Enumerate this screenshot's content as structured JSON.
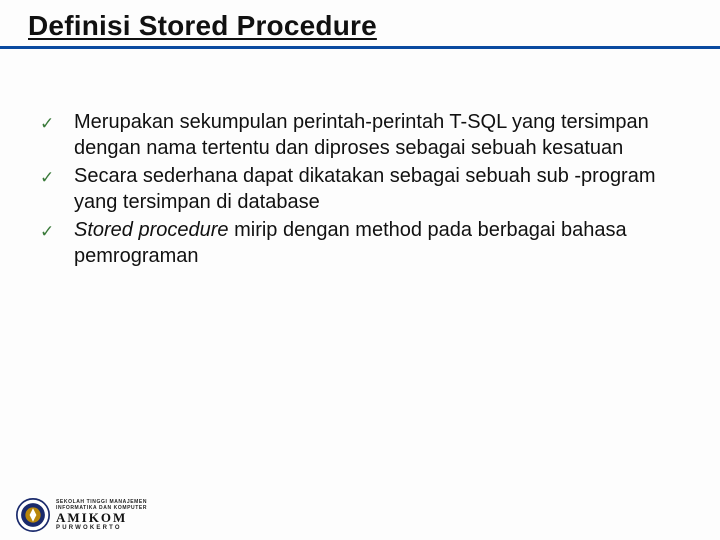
{
  "title": "Definisi Stored Procedure",
  "bullets": [
    {
      "text": "Merupakan sekumpulan perintah-perintah T-SQL yang tersimpan dengan nama tertentu dan diproses sebagai sebuah kesatuan",
      "italic_prefix": ""
    },
    {
      "text": "Secara sederhana dapat dikatakan sebagai sebuah sub -program yang tersimpan di database",
      "italic_prefix": ""
    },
    {
      "text": " mirip dengan method pada berbagai bahasa pemrograman",
      "italic_prefix": "Stored procedure"
    }
  ],
  "checkmark": "✓",
  "footer": {
    "line1_a": "SEKOLAH TINGGI MANAJEMEN",
    "line1_b": "INFORMATIKA DAN KOMPUTER",
    "name": "AMIKOM",
    "city": "PURWOKERTO"
  }
}
